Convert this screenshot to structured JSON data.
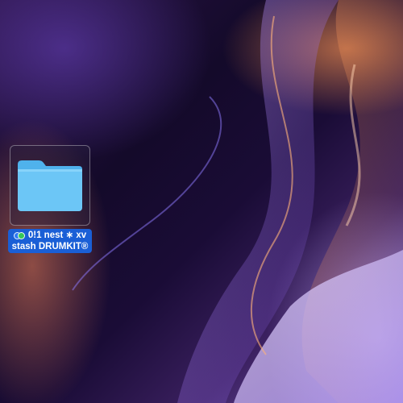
{
  "desktop": {
    "items": [
      {
        "type": "folder",
        "icon": "folder-icon",
        "selected": true,
        "name_line1": "0!1 nest ∗ xv",
        "name_line2": "stash DRUMKIT®",
        "tags": [
          {
            "name": "tag-dot-blue",
            "color": "#2f7bf5"
          },
          {
            "name": "tag-dot-green",
            "color": "#35c759"
          }
        ]
      }
    ]
  },
  "colors": {
    "selection": "#1a5fd6",
    "folder_body": "#6cc6f6",
    "folder_tab": "#4fb2ec"
  }
}
